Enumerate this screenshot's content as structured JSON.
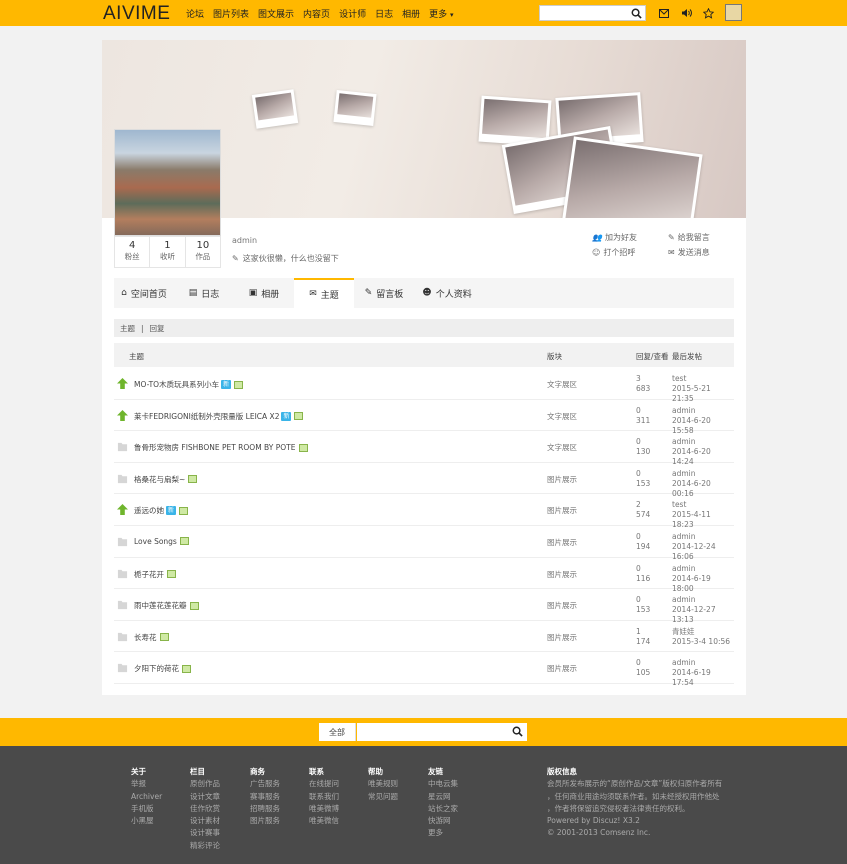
{
  "header": {
    "logo": "AIVIME",
    "nav": [
      "论坛",
      "图片列表",
      "图文展示",
      "内容页",
      "设计师",
      "日志",
      "相册",
      "更多"
    ]
  },
  "profile": {
    "username": "admin",
    "signature": "这家伙很懒，什么也没留下",
    "stats": [
      {
        "value": "4",
        "label": "粉丝"
      },
      {
        "value": "1",
        "label": "收听"
      },
      {
        "value": "10",
        "label": "作品"
      }
    ],
    "actions": [
      "加为好友",
      "给我留言",
      "打个招呼",
      "发送消息"
    ]
  },
  "tabs": [
    "空间首页",
    "日志",
    "相册",
    "主题",
    "留言板",
    "个人资料"
  ],
  "breadcrumb": [
    "主题",
    "回复"
  ],
  "table": {
    "headers": {
      "subject": "主题",
      "forum": "版块",
      "replies": "回复/查看",
      "lastpost": "最后发帖"
    },
    "rows": [
      {
        "title": "MO-TO木质玩具系列小车",
        "badge": "新",
        "hot": true,
        "forum": "文字展区",
        "replies": "3",
        "views": "683",
        "user": "test",
        "time": "2015-5-21 21:35"
      },
      {
        "title": "莱卡FEDRIGONI纸制外壳限量版 LEICA X2",
        "badge": "新",
        "hot": true,
        "forum": "文字展区",
        "replies": "0",
        "views": "311",
        "user": "admin",
        "time": "2014-6-20 15:58"
      },
      {
        "title": "鲁骨形宠物房 FISHBONE PET ROOM BY POTE",
        "badge": "",
        "hot": false,
        "forum": "文字展区",
        "replies": "0",
        "views": "130",
        "user": "admin",
        "time": "2014-6-20 14:24"
      },
      {
        "title": "格桑花与扇梨~",
        "badge": "",
        "hot": false,
        "forum": "图片展示",
        "replies": "0",
        "views": "153",
        "user": "admin",
        "time": "2014-6-20 00:16"
      },
      {
        "title": "遥远の她",
        "badge": "新",
        "hot": true,
        "forum": "图片展示",
        "replies": "2",
        "views": "574",
        "user": "test",
        "time": "2015-4-11 18:23"
      },
      {
        "title": "Love Songs",
        "badge": "",
        "hot": false,
        "forum": "图片展示",
        "replies": "0",
        "views": "194",
        "user": "admin",
        "time": "2014-12-24 16:06"
      },
      {
        "title": "栀子花开",
        "badge": "",
        "hot": false,
        "forum": "图片展示",
        "replies": "0",
        "views": "116",
        "user": "admin",
        "time": "2014-6-19 18:00"
      },
      {
        "title": "雨中莲花莲花瓣",
        "badge": "",
        "hot": false,
        "forum": "图片展示",
        "replies": "0",
        "views": "153",
        "user": "admin",
        "time": "2014-12-27 13:13"
      },
      {
        "title": "长寿花",
        "badge": "",
        "hot": false,
        "forum": "图片展示",
        "replies": "1",
        "views": "174",
        "user": "青娃娃",
        "time": "2015-3-4 10:56"
      },
      {
        "title": "夕阳下的荷花",
        "badge": "",
        "hot": false,
        "forum": "图片展示",
        "replies": "0",
        "views": "105",
        "user": "admin",
        "time": "2014-6-19 17:54"
      }
    ]
  },
  "search": {
    "scope": "全部"
  },
  "footer": {
    "columns": [
      {
        "title": "关于",
        "items": [
          "举报",
          "Archiver",
          "手机版",
          "小黑屋"
        ]
      },
      {
        "title": "栏目",
        "items": [
          "原创作品",
          "设计文章",
          "佳作欣赏",
          "设计素材",
          "设计赛事",
          "精彩评论"
        ]
      },
      {
        "title": "商务",
        "items": [
          "广告服务",
          "赛事服务",
          "招聘服务",
          "图片服务"
        ]
      },
      {
        "title": "联系",
        "items": [
          "在线提问",
          "联系我们",
          "唯美微博",
          "唯美微信"
        ]
      },
      {
        "title": "帮助",
        "items": [
          "唯美规则",
          "常见问题"
        ]
      },
      {
        "title": "友链",
        "items": [
          "中电云集",
          "星云网",
          "站长之家",
          "快游网",
          "更多"
        ]
      }
    ],
    "copyright": {
      "title": "版权信息",
      "lines": [
        "会员所发布展示的“原创作品/文章”版权归原作者所有",
        "，任何商业用途均须联系作者。如未经授权用作他处",
        "，作者将保留追究侵权者法律责任的权利。",
        "Powered by Discuz! X3.2",
        "© 2001-2013 Comsenz Inc."
      ]
    }
  }
}
